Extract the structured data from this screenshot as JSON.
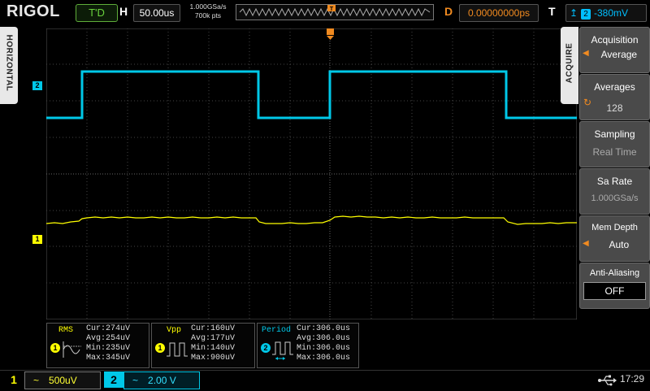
{
  "top": {
    "brand": "RIGOL",
    "run_status": "T'D",
    "h_label": "H",
    "timebase": "50.00us",
    "sample_rate": "1.000GSa/s",
    "mem_points": "700k pts",
    "d_label": "D",
    "trigger_delay": "0.00000000ps",
    "t_label": "T",
    "trigger_source": "2",
    "trigger_level": "-380mV"
  },
  "side_tabs": {
    "left": "HORIZONTAL",
    "right": "ACQUIRE"
  },
  "channels": {
    "ch1": {
      "marker": "1",
      "coupling_icon": "ac-tilde-icon",
      "scale": "500uV",
      "color": "#ffff00"
    },
    "ch2": {
      "marker": "2",
      "coupling_icon": "ac-tilde-icon",
      "scale": "2.00 V",
      "color": "#00c8e8"
    }
  },
  "menu": {
    "acquisition": {
      "label": "Acquisition",
      "value": "Average"
    },
    "averages": {
      "label": "Averages",
      "value": "128"
    },
    "sampling": {
      "label": "Sampling",
      "value": "Real Time"
    },
    "sa_rate": {
      "label": "Sa Rate",
      "value": "1.000GSa/s"
    },
    "mem_depth": {
      "label": "Mem Depth",
      "value": "Auto"
    },
    "anti_aliasing": {
      "label": "Anti-Aliasing",
      "value": "OFF"
    }
  },
  "measurements": [
    {
      "name": "RMS",
      "channel": "1",
      "icon": "rms-waveform-icon",
      "cur": "Cur:274uV",
      "avg": "Avg:254uV",
      "min": "Min:235uV",
      "max": "Max:345uV"
    },
    {
      "name": "Vpp",
      "channel": "1",
      "icon": "vpp-pulse-icon",
      "cur": "Cur:160uV",
      "avg": "Avg:177uV",
      "min": "Min:140uV",
      "max": "Max:900uV"
    },
    {
      "name": "Period",
      "channel": "2",
      "icon": "period-pulse-icon",
      "cur": "Cur:306.0us",
      "avg": "Avg:306.0us",
      "min": "Min:306.0us",
      "max": "Max:306.0us"
    }
  ],
  "status": {
    "clock": "17:29",
    "usb_icon": "usb-icon"
  },
  "colors": {
    "ch1": "#ffff00",
    "ch2": "#00c8e8",
    "trigger": "#f08a20",
    "run": "#69d23c"
  }
}
